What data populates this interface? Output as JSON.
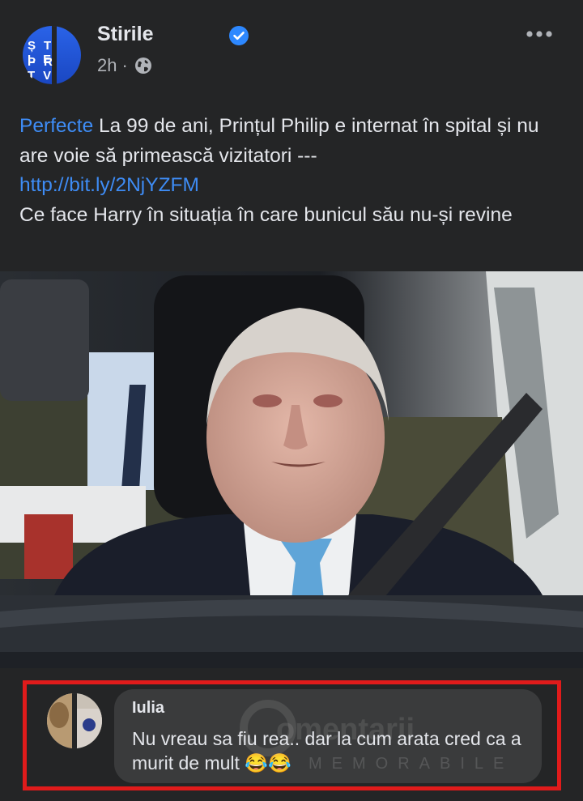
{
  "post": {
    "page_name": "Stirile",
    "avatar_text_top": "ȘTIRILE",
    "avatar_text_bottom": "PRO TV",
    "time": "2h",
    "separator": "·",
    "text_link_label": "Perfecte",
    "text_line1": " La 99 de ani, Prințul Philip e internat în spital și nu are voie să primească vizitatori ---",
    "url": "http://bit.ly/2NjYZFM",
    "text_line2": "Ce face Harry în situația în care bunicul său nu-și revine"
  },
  "comment": {
    "author": "Iulia",
    "text": "Nu vreau sa fiu rea.. dar la cum arata cred ca a murit de mult 😂😂"
  },
  "watermark": {
    "top": "Comentarii",
    "bottom": "MEMORABILE"
  },
  "icons": [
    "verified-badge-icon",
    "globe-icon",
    "more-options-icon"
  ],
  "colors": {
    "background": "#242526",
    "link": "#3e8cf5",
    "verified": "#2d88ff",
    "highlight_border": "#e01b1b",
    "bubble": "#3a3b3c"
  }
}
